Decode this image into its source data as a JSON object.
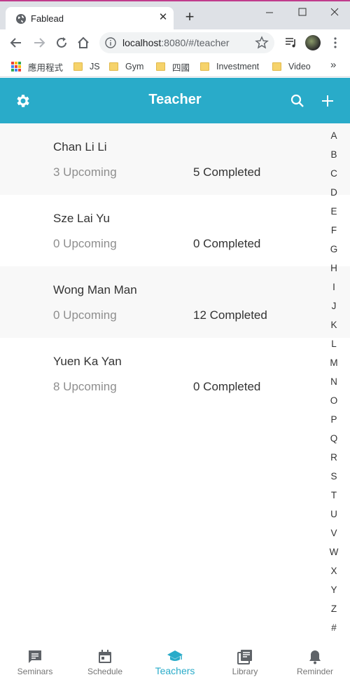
{
  "browser": {
    "tab_title": "Fablead",
    "url_host": "localhost",
    "url_path": ":8080/#/teacher",
    "bookmarks": [
      "應用程式",
      "JS",
      "Gym",
      "四國",
      "Investment",
      "Video"
    ]
  },
  "header": {
    "title": "Teacher"
  },
  "teachers": [
    {
      "name": "Chan Li Li",
      "upcoming": "3 Upcoming",
      "completed": "5 Completed"
    },
    {
      "name": "Sze Lai Yu",
      "upcoming": "0 Upcoming",
      "completed": "0 Completed"
    },
    {
      "name": "Wong Man Man",
      "upcoming": "0 Upcoming",
      "completed": "12 Completed"
    },
    {
      "name": "Yuen Ka Yan",
      "upcoming": "8 Upcoming",
      "completed": "0 Completed"
    }
  ],
  "alphabet": [
    "A",
    "B",
    "C",
    "D",
    "E",
    "F",
    "G",
    "H",
    "I",
    "J",
    "K",
    "L",
    "M",
    "N",
    "O",
    "P",
    "Q",
    "R",
    "S",
    "T",
    "U",
    "V",
    "W",
    "X",
    "Y",
    "Z",
    "#"
  ],
  "bottom_nav": [
    {
      "label": "Seminars",
      "icon": "chat-icon"
    },
    {
      "label": "Schedule",
      "icon": "calendar-icon"
    },
    {
      "label": "Teachers",
      "icon": "graduation-cap-icon",
      "active": true
    },
    {
      "label": "Library",
      "icon": "library-icon"
    },
    {
      "label": "Reminder",
      "icon": "bell-icon"
    }
  ],
  "colors": {
    "accent": "#29abc9",
    "muted_text": "#8e8e8e",
    "row_shade": "#f8f8f8"
  }
}
